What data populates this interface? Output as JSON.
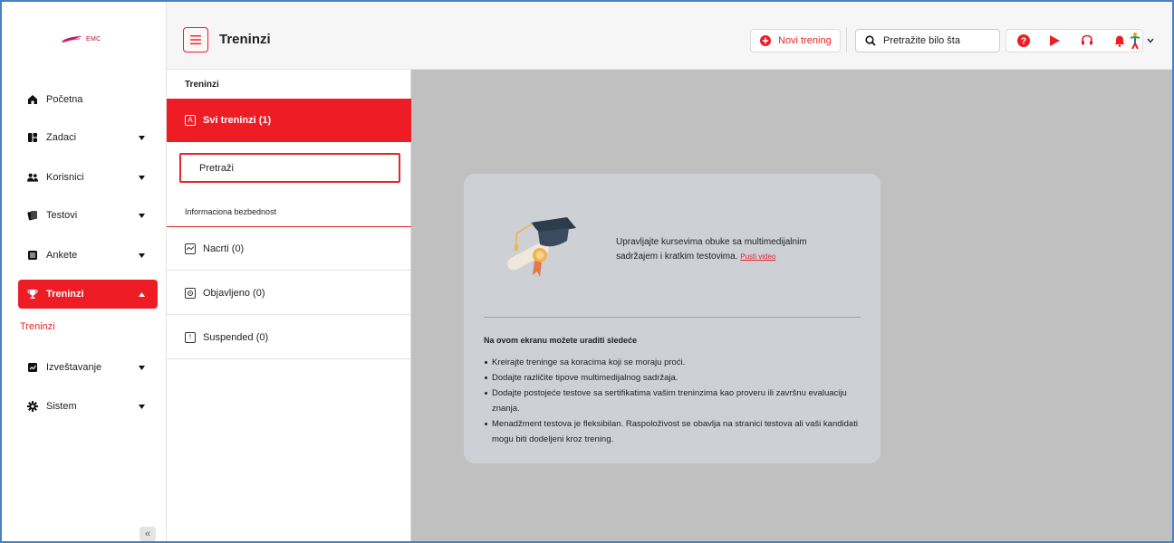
{
  "brand": {
    "logo_text": "EMC"
  },
  "sidebar": {
    "items": [
      {
        "label": "Početna",
        "icon": "home-icon",
        "has_chevron": false
      },
      {
        "label": "Zadaci",
        "icon": "tasks-icon",
        "has_chevron": true
      },
      {
        "label": "Korisnici",
        "icon": "users-icon",
        "has_chevron": true
      },
      {
        "label": "Testovi",
        "icon": "tests-icon",
        "has_chevron": true
      },
      {
        "label": "Ankete",
        "icon": "surveys-icon",
        "has_chevron": true
      },
      {
        "label": "Treninzi",
        "icon": "trophy-icon",
        "has_chevron": true,
        "active": true
      },
      {
        "label": "Izveštavanje",
        "icon": "report-icon",
        "has_chevron": true
      },
      {
        "label": "Sistem",
        "icon": "gear-icon",
        "has_chevron": true
      }
    ],
    "sub_item": "Treninzi",
    "collapse_label": "«"
  },
  "header": {
    "title": "Treninzi",
    "new_button_label": "Novi trening",
    "search_placeholder": "Pretražite bilo šta",
    "icons": [
      "help-icon",
      "play-icon",
      "headset-icon",
      "bell-icon"
    ]
  },
  "list_panel": {
    "heading": "Treninzi",
    "active_row": {
      "label": "Svi treninzi (1)",
      "icon": "all-icon"
    },
    "search_label": "Pretraži",
    "category_label": "Informaciona bezbednost",
    "rows": [
      {
        "label": "Nacrti (0)",
        "icon": "draft-icon"
      },
      {
        "label": "Objavljeno (0)",
        "icon": "published-icon"
      },
      {
        "label": "Suspended (0)",
        "icon": "suspended-icon"
      }
    ]
  },
  "main_card": {
    "intro": "Upravljajte kursevima obuke sa multimedijalnim sadržajem i kratkim testovima.",
    "video_link": "Pusti video",
    "heading": "Na ovom ekranu možete uraditi sledeće",
    "bullets": [
      "Kreirajte treninge sa koracima koji se moraju proći.",
      "Dodajte različite tipove multimedijalnog sadržaja.",
      "Dodajte postojeće testove sa sertifikatima vašim treninzima kao proveru ili završnu evaluaciju znanja.",
      "Menadžment testova je fleksibilan. Raspoloživost se obavlja na stranici testova ali vaši kandidati mogu biti dodeljeni kroz trening."
    ]
  },
  "colors": {
    "accent": "#ee1c25",
    "main_bg": "#c0c0c0",
    "card_bg": "#cdd1d5",
    "header_bg": "#f6f6f6"
  }
}
